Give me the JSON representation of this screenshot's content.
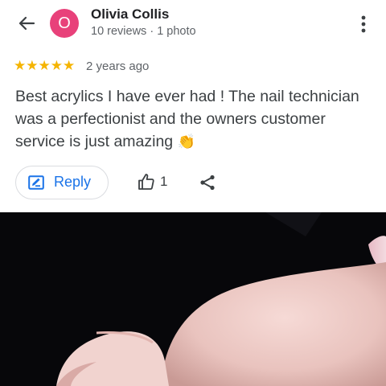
{
  "header": {
    "back_icon": "arrow-left-icon",
    "avatar_initial": "O",
    "avatar_color": "#e8417a",
    "reviewer_name": "Olivia Collis",
    "reviewer_meta": "10 reviews · 1 photo",
    "more_icon": "more-vert-icon"
  },
  "review": {
    "stars": "★★★★★",
    "rating": 5,
    "star_color": "#f5b400",
    "age": "2 years ago",
    "text": "Best acrylics I have ever had ! The nail technician was a perfectionist and the owners customer service is just amazing",
    "emoji": "👏"
  },
  "actions": {
    "reply_label": "Reply",
    "reply_icon": "reply-edit-icon",
    "like_icon": "thumbs-up-icon",
    "like_count": "1",
    "share_icon": "share-icon",
    "accent_color": "#1a73e8"
  },
  "photo": {
    "description_icon": "review-photo"
  }
}
